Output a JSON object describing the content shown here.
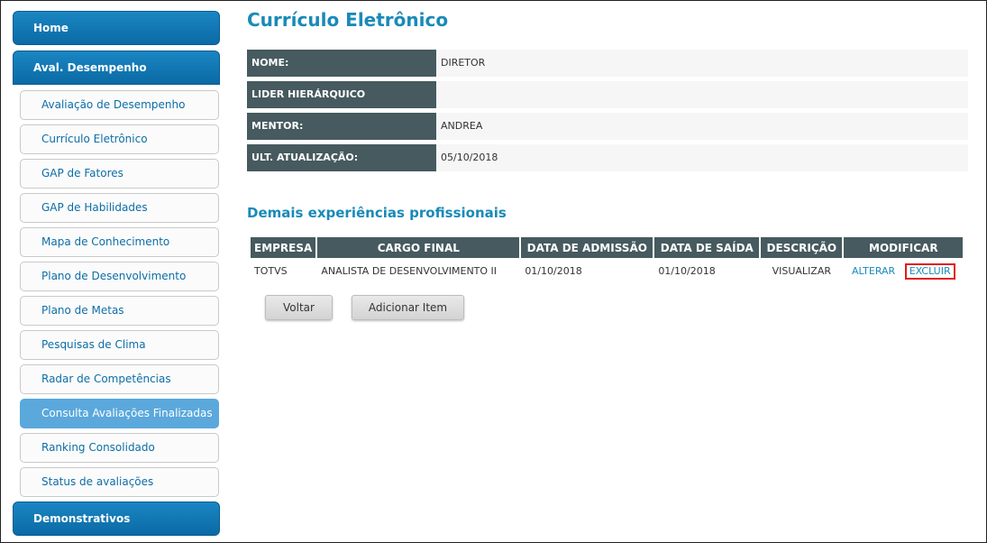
{
  "sidebar": {
    "home": "Home",
    "aval_desempenho": "Aval. Desempenho",
    "items": [
      {
        "label": "Avaliação de Desempenho"
      },
      {
        "label": "Currículo Eletrônico"
      },
      {
        "label": "GAP de Fatores"
      },
      {
        "label": "GAP de Habilidades"
      },
      {
        "label": "Mapa de Conhecimento"
      },
      {
        "label": "Plano de Desenvolvimento"
      },
      {
        "label": "Plano de Metas"
      },
      {
        "label": "Pesquisas de Clima"
      },
      {
        "label": "Radar de Competências"
      },
      {
        "label": "Consulta Avaliações Finalizadas",
        "active": true
      },
      {
        "label": "Ranking Consolidado"
      },
      {
        "label": "Status de avaliações"
      }
    ],
    "demonstrativos": "Demonstrativos"
  },
  "main": {
    "title": "Currículo Eletrônico",
    "info": [
      {
        "label": "NOME:",
        "value": "DIRETOR"
      },
      {
        "label": "LIDER HIERÁRQUICO",
        "value": ""
      },
      {
        "label": "MENTOR:",
        "value": "ANDREA"
      },
      {
        "label": "ULT. ATUALIZAÇÃO:",
        "value": "05/10/2018"
      }
    ],
    "section_title": "Demais experiências profissionais",
    "table": {
      "headers": [
        "EMPRESA",
        "CARGO FINAL",
        "DATA DE ADMISSÃO",
        "DATA DE SAÍDA",
        "DESCRIÇÃO",
        "MODIFICAR"
      ],
      "rows": [
        {
          "empresa": "TOTVS",
          "cargo": "ANALISTA DE DESENVOLVIMENTO II",
          "admissao": "01/10/2018",
          "saida": "01/10/2018",
          "descricao": "VISUALIZAR",
          "alterar": "ALTERAR",
          "excluir": "EXCLUIR"
        }
      ]
    },
    "buttons": {
      "voltar": "Voltar",
      "adicionar": "Adicionar Item"
    }
  },
  "colors": {
    "accent": "#1a8ab8",
    "nav_blue": "#0b6aa5",
    "active_sub": "#5aa8dc",
    "header_dark": "#465a5f",
    "highlight": "#e01b1b"
  }
}
